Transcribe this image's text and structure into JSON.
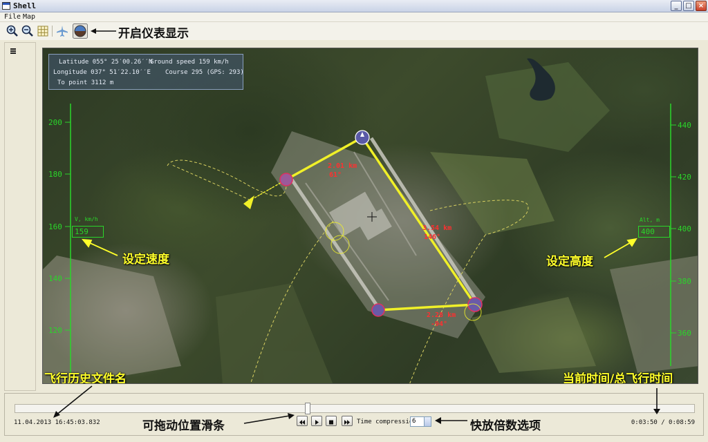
{
  "window": {
    "title": "Shell"
  },
  "menu": {
    "file": "File",
    "map": "Map"
  },
  "toolbar": {
    "annotation": "开启仪表显示"
  },
  "map": {
    "info": {
      "latitude": "Latitude 055° 25′00.26′′N",
      "ground_speed": "Ground speed 159 km/h",
      "longitude": "Longitude 037° 51′22.10′′E",
      "course": "Course 295 (GPS: 293)",
      "to_point": "To point 3112 m"
    },
    "speed_scale": {
      "title": "V, km/h",
      "ticks": [
        "200",
        "180",
        "160",
        "140",
        "120"
      ],
      "value": "159"
    },
    "alt_scale": {
      "title": "Alt, m",
      "ticks": [
        "440",
        "420",
        "400",
        "380",
        "360"
      ],
      "value": "400"
    },
    "legs": [
      {
        "dist": "2.01 km",
        "course": "61°"
      },
      {
        "dist": "3.54 km",
        "course": "146°"
      },
      {
        "dist": "2.28 km",
        "course": "-94°"
      }
    ],
    "annotations": {
      "set_speed": "设定速度",
      "set_altitude": "设定高度",
      "history_file": "飞行历史文件名",
      "time": "当前时间/总飞行时间"
    },
    "colors": {
      "route": "#f0f028",
      "scale": "#2ad62a",
      "leg_label": "#ff3030",
      "annotation": "#ffff2a"
    }
  },
  "playback": {
    "datetime": "11.04.2013 16:45:03.832",
    "time": "0:03:50 / 0:08:59",
    "slider_annotation": "可拖动位置滑条",
    "time_compression_label": "Time compression:",
    "time_compression_value": "6",
    "speed_annotation": "快放倍数选项"
  }
}
